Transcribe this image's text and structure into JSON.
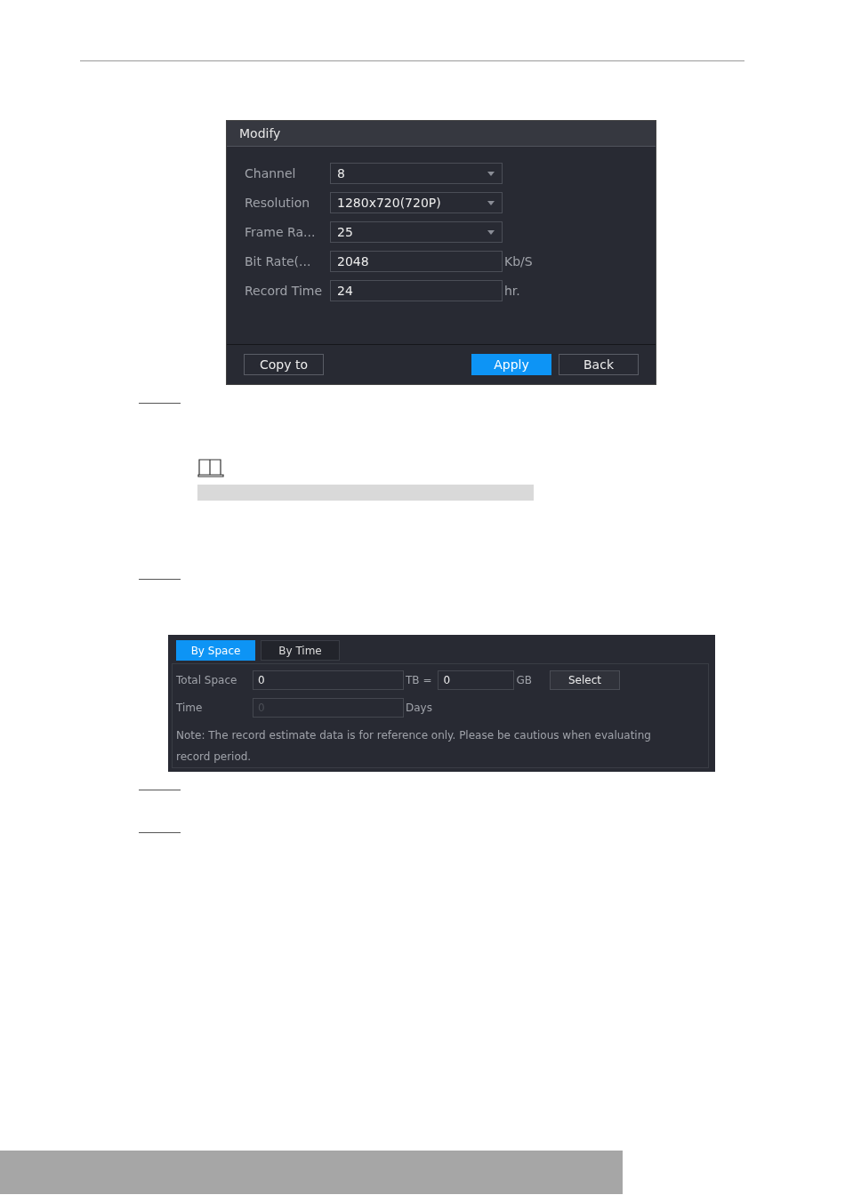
{
  "modify_dialog": {
    "title": "Modify",
    "fields": [
      {
        "kind": "select",
        "label": "Channel",
        "value": "8"
      },
      {
        "kind": "select",
        "label": "Resolution",
        "value": "1280x720(720P)"
      },
      {
        "kind": "select",
        "label": "Frame Ra...",
        "value": "25"
      },
      {
        "kind": "input",
        "label": "Bit Rate(...",
        "value": "2048",
        "unit": "Kb/S"
      },
      {
        "kind": "input",
        "label": "Record Time",
        "value": "24",
        "unit": "hr."
      }
    ],
    "buttons": [
      {
        "label": "Copy to",
        "primary": false
      },
      {
        "label": "Apply",
        "primary": true
      },
      {
        "label": "Back",
        "primary": false
      }
    ]
  },
  "estimate_panel": {
    "tabs": [
      {
        "label": "By Space",
        "selected": true
      },
      {
        "label": "By Time",
        "selected": false
      }
    ],
    "total_space": {
      "label": "Total Space",
      "tb_value": "0",
      "tb_unit": "TB =",
      "gb_value": "0",
      "gb_unit": "GB",
      "button": "Select"
    },
    "time": {
      "label": "Time",
      "value": "0",
      "disabled": true,
      "unit": "Days"
    },
    "note": "Note: The record estimate data is for reference only. Please be cautious when evaluating record period."
  }
}
